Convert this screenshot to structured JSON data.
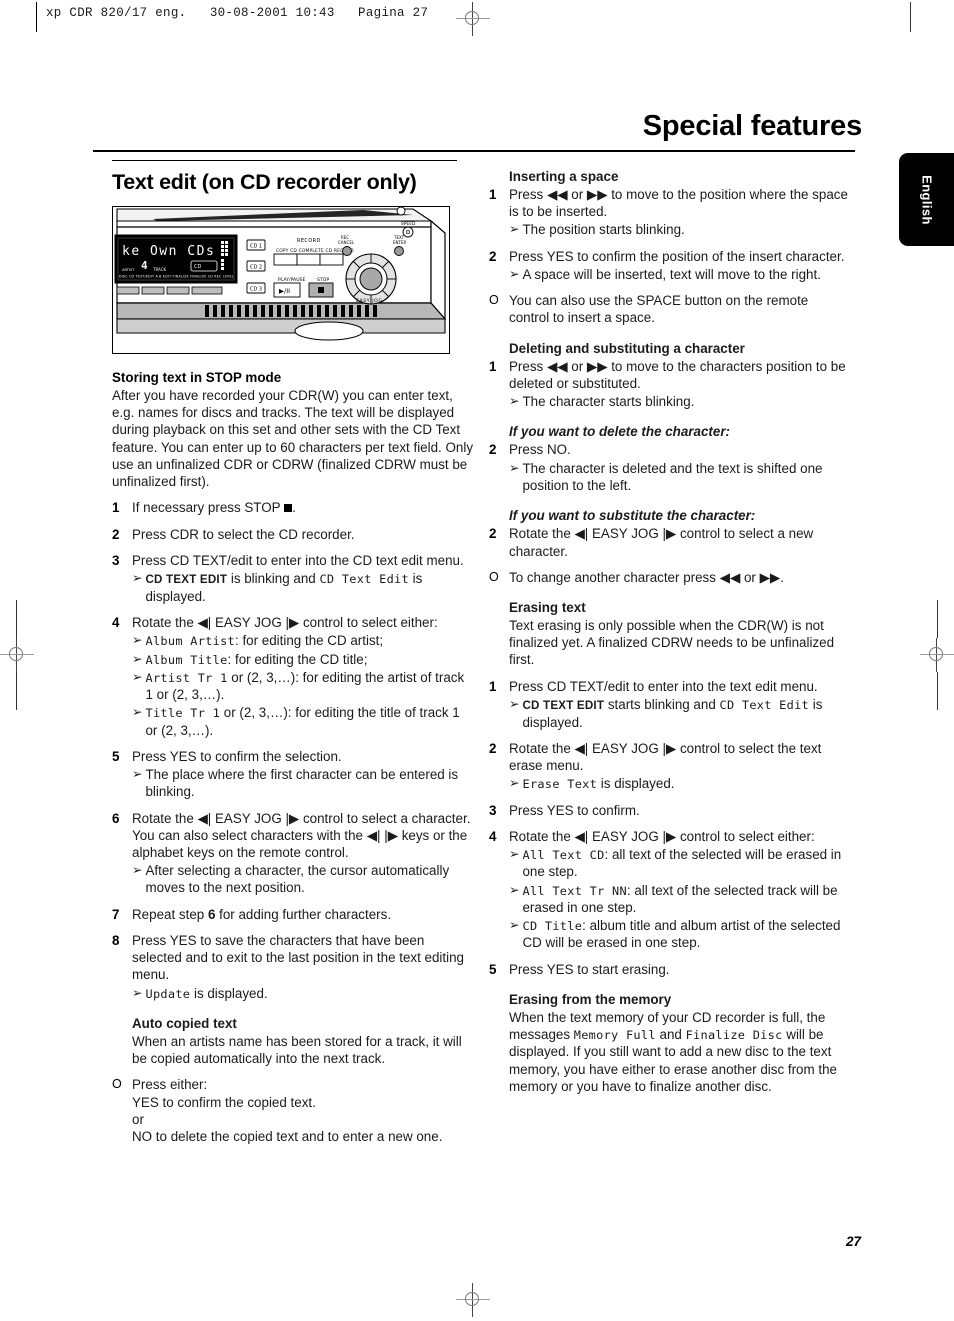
{
  "print_slug": "xp CDR 820/17 eng.   30-08-2001 10:43   Pagina 27",
  "chapter_title": "Special features",
  "language_tab": "English",
  "folio": "27",
  "left": {
    "section_title": "Text edit (on CD recorder only)",
    "illustration": {
      "name": "cd-recorder-front-panel",
      "display_text": "ke Own CDs",
      "display_track": "4",
      "labels": {
        "record": "RECORD",
        "copy_cd": "COPY CD COMPLETE CD RECORD",
        "play_pause": "PLAY/PAUSE",
        "stop": "STOP",
        "play_pause_glyph": "▶/II",
        "cd1": "CD 1",
        "cd2": "CD 2",
        "cd3": "CD 3",
        "speed": "SPEED",
        "rec_cancel": "REC CANCEL",
        "text_enter": "TEXT ENTER",
        "easy_jog": "EASY JOG",
        "status_row": "CD TEXT EDIT   A-B EDIT   FINALIZE   FINALIZE CD   REC LEVEL"
      }
    },
    "storing": {
      "heading": "Storing text in STOP mode",
      "paragraph": "After you have recorded your CDR(W) you can enter text, e.g. names for discs and tracks. The text will be displayed during playback on this set and other sets with the CD Text feature. You can enter up to 60 characters per text field. Only use an unfinalized CDR or CDRW (finalized CDRW must be unfinalized first)."
    },
    "steps": [
      {
        "num": "1",
        "text_pre": "If necessary press STOP ",
        "text_post": ".",
        "has_stop_square": true
      },
      {
        "num": "2",
        "text": "Press CDR to select the CD recorder."
      },
      {
        "num": "3",
        "text": "Press CD TEXT/edit to enter into the CD text edit menu.",
        "results": [
          {
            "caps": "CD TEXT EDIT",
            "mid": " is blinking and ",
            "lcd": "CD Text Edit",
            "post": " is displayed."
          }
        ]
      },
      {
        "num": "4",
        "text": "Rotate the ◀| EASY JOG |▶ control to select either:",
        "results": [
          {
            "lcd": "Album Artist",
            "post": ": for editing the CD artist;"
          },
          {
            "lcd": "Album Title",
            "post": ": for editing the CD title;"
          },
          {
            "lcd": "Artist Tr 1",
            "post": " or (2, 3,…): for editing the artist of track 1 or (2, 3,…)."
          },
          {
            "lcd": "Title Tr 1",
            "post": " or (2, 3,…): for editing the title of track 1 or (2, 3,…)."
          }
        ]
      },
      {
        "num": "5",
        "text": "Press YES to confirm the selection.",
        "results": [
          {
            "post": "The place where the first character can be entered is blinking."
          }
        ]
      },
      {
        "num": "6",
        "text": "Rotate the ◀| EASY JOG |▶ control to select a character. You can also select characters with the ◀| |▶ keys or the alphabet keys on the remote control.",
        "results": [
          {
            "post": "After selecting a character, the cursor automatically moves to the next position."
          }
        ]
      },
      {
        "num": "7",
        "text_pre": "Repeat step ",
        "bold": "6",
        "text_post": " for adding further characters."
      },
      {
        "num": "8",
        "text": "Press YES to save the characters that have been selected and to exit to the last position in the text editing menu.",
        "results": [
          {
            "lcd": "Update",
            "post": " is displayed."
          }
        ]
      }
    ],
    "auto_copied": {
      "heading": "Auto copied text",
      "paragraph": "When an artists name has been stored for a track, it will be copied automatically into the next track.",
      "bullet": {
        "marker": "O",
        "lines": [
          "Press either:",
          "YES to confirm the copied text.",
          "or",
          "NO to delete the copied text and to enter a new one."
        ]
      }
    }
  },
  "right": {
    "inserting_space": {
      "heading": "Inserting a space",
      "steps": [
        {
          "num": "1",
          "text": "Press ◀◀ or ▶▶ to move to the position where the space is to be inserted.",
          "results": [
            {
              "post": "The position starts blinking."
            }
          ]
        },
        {
          "num": "2",
          "text": "Press YES to confirm the position of the insert character.",
          "results": [
            {
              "post": "A space will be inserted, text will move to the right."
            }
          ]
        },
        {
          "num": "O",
          "is_bullet": true,
          "text": "You can also use the SPACE button on the remote control to insert a space."
        }
      ]
    },
    "deleting": {
      "heading": "Deleting and substituting a character",
      "steps": [
        {
          "num": "1",
          "text": "Press ◀◀ or ▶▶ to move to the characters position to be deleted or substituted.",
          "results": [
            {
              "post": "The character starts blinking."
            }
          ]
        }
      ],
      "delete_heading": "If you want to delete the character:",
      "delete_steps": [
        {
          "num": "2",
          "text": "Press NO.",
          "results": [
            {
              "post": "The character is deleted and the text is shifted one position to the left."
            }
          ]
        }
      ],
      "substitute_heading": "If you want to substitute the character:",
      "substitute_steps": [
        {
          "num": "2",
          "text": "Rotate the ◀| EASY JOG |▶ control to select a new character."
        },
        {
          "num": "O",
          "is_bullet": true,
          "text": "To change another character press ◀◀ or ▶▶."
        }
      ]
    },
    "erasing_text": {
      "heading": "Erasing text",
      "paragraph": "Text erasing is only possible when the CDR(W) is not finalized yet. A finalized CDRW needs to be unfinalized first.",
      "steps": [
        {
          "num": "1",
          "text": "Press CD TEXT/edit  to enter into the text edit menu.",
          "results": [
            {
              "caps": "CD TEXT EDIT",
              "mid": " starts blinking and ",
              "lcd": "CD Text Edit",
              "post": " is displayed."
            }
          ]
        },
        {
          "num": "2",
          "text": "Rotate the ◀| EASY JOG |▶ control to select the text erase menu.",
          "results": [
            {
              "lcd": "Erase Text",
              "post": " is displayed."
            }
          ]
        },
        {
          "num": "3",
          "text": "Press YES to confirm."
        },
        {
          "num": "4",
          "text": "Rotate the ◀| EASY JOG |▶ control to select either:",
          "results": [
            {
              "lcd": "All Text CD",
              "post": ": all text of the selected will be erased in one step."
            },
            {
              "lcd": "All Text Tr NN",
              "post": ": all text of the selected track will be erased in one step."
            },
            {
              "lcd": "CD Title",
              "post": ": album title and album artist of the selected CD will be erased in one step."
            }
          ]
        },
        {
          "num": "5",
          "text": "Press YES to start erasing."
        }
      ]
    },
    "erasing_memory": {
      "heading": "Erasing from the memory",
      "para_1": "When the text memory of your CD recorder is full, the messages ",
      "lcd_1": "Memory Full",
      "para_2": " and ",
      "lcd_2": "Finalize Disc",
      "para_3": " will be displayed. If you still want to add a new disc to the text memory, you have either to erase another disc from the memory or you have to finalize another disc."
    }
  }
}
